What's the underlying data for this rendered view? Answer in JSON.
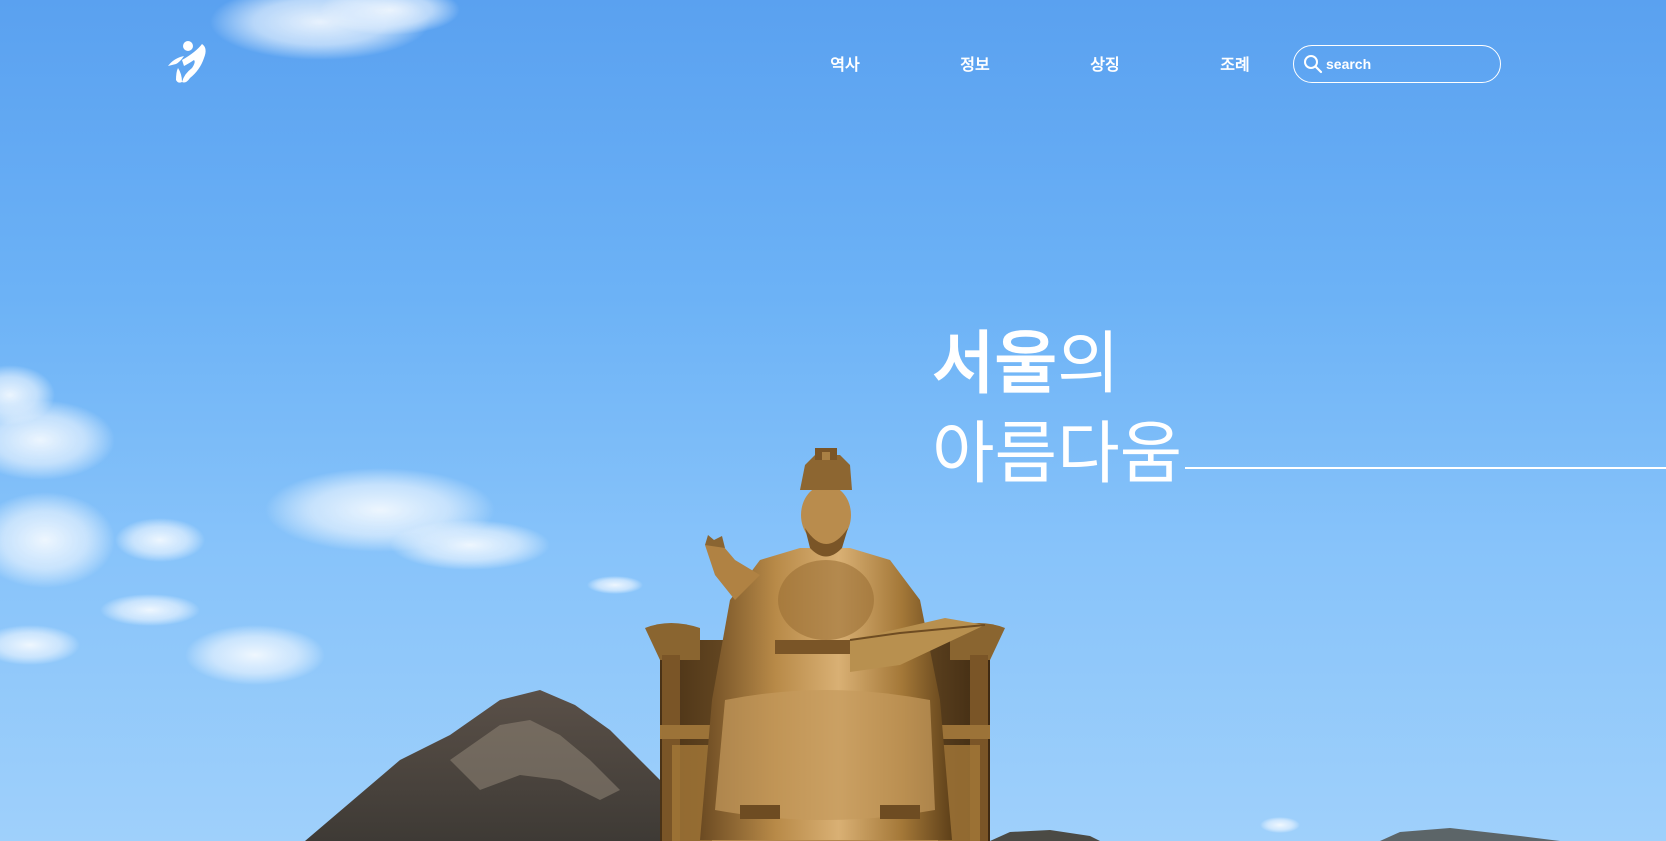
{
  "header": {
    "logo_icon": "dancing-figure-logo-icon",
    "nav": [
      {
        "label": "역사"
      },
      {
        "label": "정보"
      },
      {
        "label": "상징"
      },
      {
        "label": "조례"
      }
    ],
    "search": {
      "icon": "search-icon",
      "placeholder": "search"
    }
  },
  "hero": {
    "headline_bold": "서울",
    "headline_suffix": "의",
    "headline_line2": "아름다움",
    "background_image": "statue-of-king-sejong-with-mountain-and-sky",
    "colors": {
      "sky_top": "#5aa1f0",
      "sky_bottom": "#9fd0fb",
      "text": "#ffffff"
    }
  }
}
